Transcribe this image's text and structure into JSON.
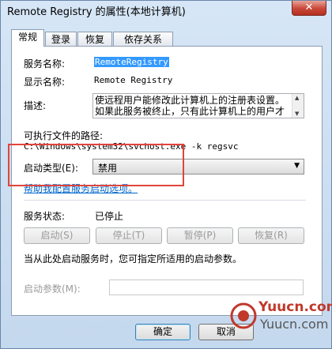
{
  "window": {
    "title": "Remote Registry 的属性(本地计算机)",
    "close_glyph": "✕"
  },
  "tabs": [
    {
      "label": "常规",
      "active": true
    },
    {
      "label": "登录",
      "active": false
    },
    {
      "label": "恢复",
      "active": false
    },
    {
      "label": "依存关系",
      "active": false
    }
  ],
  "general": {
    "service_name_label": "服务名称:",
    "service_name_value": "RemoteRegistry",
    "display_name_label": "显示名称:",
    "display_name_value": "Remote Registry",
    "description_label": "描述:",
    "description_value": "使远程用户能修改此计算机上的注册表设置。如果此服务被终止，只有此计算机上的用户才",
    "exe_path_label": "可执行文件的路径:",
    "exe_path_value": "C:\\Windows\\system32\\svchost.exe -k regsvc",
    "startup_type_label": "启动类型(E):",
    "startup_type_value": "禁用",
    "help_link": "帮助我配置服务启动选项。",
    "status_label": "服务状态:",
    "status_value": "已停止",
    "buttons": {
      "start": "启动(S)",
      "stop": "停止(T)",
      "pause": "暂停(P)",
      "resume": "恢复(R)"
    },
    "hint": "当从此处启动服务时，您可指定所适用的启动参数。",
    "param_label": "启动参数(M):",
    "param_value": ""
  },
  "dialog_buttons": {
    "ok": "确定",
    "cancel": "取消"
  },
  "watermark": {
    "line1": "Yuucn.com",
    "line2": "Yuucn.com"
  },
  "colors": {
    "accent": "#3399ff",
    "highlight_rect": "#e0453b",
    "link": "#0066cc"
  }
}
